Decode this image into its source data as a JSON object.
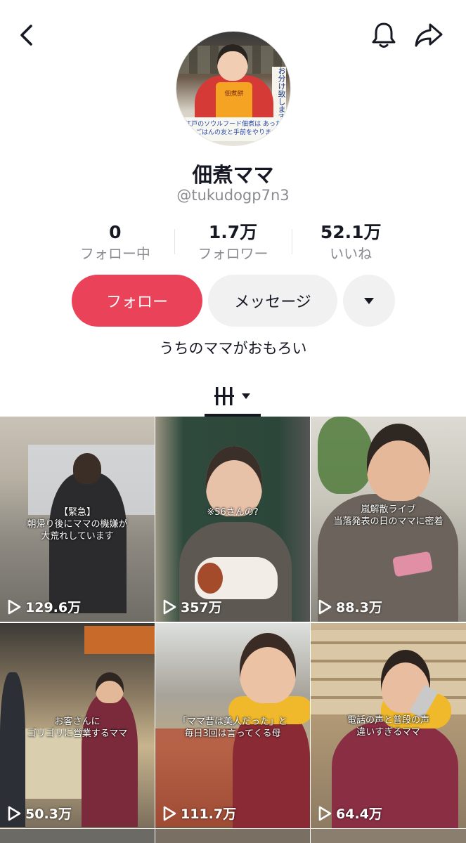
{
  "header": {
    "back_icon": "chevron-left-icon",
    "bell_icon": "bell-icon",
    "share_icon": "share-arrow-icon"
  },
  "avatar": {
    "apron_text": "佃煮餅",
    "banner_text": "江戸のソウルフード佃煮は あったかごはんの友と手前をやります",
    "side_text": "お分け致します"
  },
  "profile": {
    "name": "佃煮ママ",
    "handle": "@tukudogp7n3",
    "bio": "うちのママがおもろい"
  },
  "stats": [
    {
      "value": "0",
      "label": "フォロー中"
    },
    {
      "value": "1.7万",
      "label": "フォロワー"
    },
    {
      "value": "52.1万",
      "label": "いいね"
    }
  ],
  "actions": {
    "follow": "フォロー",
    "message": "メッセージ",
    "more_icon": "caret-down-icon"
  },
  "colors": {
    "accent": "#ea4359",
    "secondary_button": "#f1f1f2",
    "muted_text": "#8a8b91"
  },
  "videos": [
    {
      "views": "129.6万",
      "caption": "【緊急】\n朝帰り後にママの機嫌が\n大荒れしています"
    },
    {
      "views": "357万",
      "caption": "※56さんの?"
    },
    {
      "views": "88.3万",
      "caption": "嵐解散ライブ\n当落発表の日のママに密着"
    },
    {
      "views": "50.3万",
      "caption": "お客さんに\nゴリゴリに営業するママ"
    },
    {
      "views": "111.7万",
      "caption": "「ママ昔は美人だった」と\n毎日3回は言ってくる母"
    },
    {
      "views": "64.4万",
      "caption": "電話の声と普段の声\n違いすぎるママ"
    }
  ]
}
